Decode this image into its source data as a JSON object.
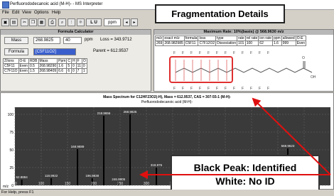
{
  "window": {
    "title": "Perfluorododecanoic acid (M-H)- - MS Interpreter"
  },
  "menu": [
    "File",
    "Edit",
    "View",
    "Options",
    "Help"
  ],
  "toolbar": {
    "lu": "L U",
    "ppm_unit": "ppm"
  },
  "calc": {
    "header": "Formula Calculator",
    "mass_label": "Mass",
    "mass_value": "268.9825",
    "tol_value": "40",
    "ppm_label": "ppm",
    "loss_text": "Loss = 343.9712",
    "formula_label": "Formula",
    "formula_value": "[C5F11O2]",
    "parent_text": "Parent = 612.9537",
    "table_header": [
      "Z/ions",
      "O-E",
      "RDB",
      "Mass",
      "Ppm",
      "C",
      "H",
      "F",
      "O"
    ],
    "table_rows": [
      [
        "C5F11",
        "Even",
        "0.5",
        "268.98290",
        "1.6",
        "5",
        "0",
        "11",
        "0"
      ],
      [
        "C7F11O",
        "Even",
        "1.5",
        "268.98409",
        "6.6",
        "6",
        "0",
        "7",
        "1"
      ]
    ]
  },
  "results": {
    "header": "Maximum Rate: 10%(basis) @ 568.9630 m/z",
    "columns": [
      "m/z",
      "exact m/z",
      "formula",
      "loss",
      "type",
      "rate",
      "rel rate",
      "ion rate",
      "ppm",
      "allowed",
      "O-E"
    ],
    "row": [
      "269",
      "268.982985",
      "C5F11",
      "C7F12O2",
      "Dissociation",
      "101",
      "100",
      "62",
      "1.6",
      "999",
      "Even"
    ]
  },
  "callouts": {
    "fragmentation": "Fragmentation Details",
    "id_line1": "Black Peak: Identified",
    "id_line2": "White: No ID"
  },
  "spectrum": {
    "title": "Mass Spectrum for C12HF23O2(-H), Mass = 612.9537, CAS = 307-55-1 (M-H)-",
    "subtitle": "Perfluorododecanoic acid (M-H)-",
    "xlabel": "m/z",
    "ylabel": "",
    "xlim": [
      50,
      650
    ],
    "ylim": [
      0,
      110
    ]
  },
  "chart_data": {
    "type": "bar",
    "title": "Mass Spectrum for C12HF23O2(-H), Mass = 612.9537, CAS = 307-55-1 (M-H)-",
    "xlabel": "m/z",
    "ylabel": "",
    "x_ticks": [
      50,
      100,
      150,
      200,
      250,
      300,
      350,
      400,
      450,
      500,
      550,
      600
    ],
    "y_ticks": [
      0,
      25,
      50,
      75,
      100
    ],
    "xlim": [
      50,
      650
    ],
    "ylim": [
      0,
      110
    ],
    "peaks": [
      {
        "mz": 62.9884,
        "y": 8,
        "label": "62.9884",
        "identified": true
      },
      {
        "mz": 118.9922,
        "y": 10,
        "label": "118.9922",
        "identified": true
      },
      {
        "mz": 168.9889,
        "y": 51,
        "label": "168.9889",
        "identified": true
      },
      {
        "mz": 196.9838,
        "y": 10,
        "label": "196.9838",
        "identified": true
      },
      {
        "mz": 218.9856,
        "y": 98,
        "label": "218.9856",
        "identified": true
      },
      {
        "mz": 246.9805,
        "y": 5,
        "label": "246.9805",
        "identified": true
      },
      {
        "mz": 268.9825,
        "y": 100,
        "label": "268.9825",
        "identified": true
      },
      {
        "mz": 318.976,
        "y": 25,
        "label": "318.976",
        "identified": true
      },
      {
        "mz": 418.9729,
        "y": 18,
        "label": "418.9729",
        "identified": true
      },
      {
        "mz": 568.9623,
        "y": 52,
        "label": "568.9623",
        "identified": true
      }
    ]
  },
  "status": "For Help, press F1"
}
